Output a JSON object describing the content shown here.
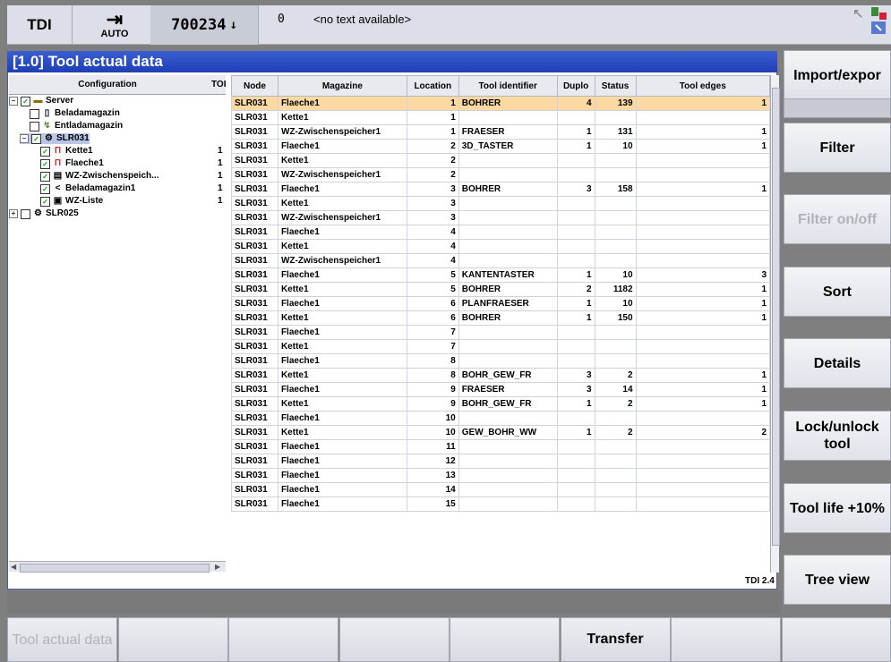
{
  "topbar": {
    "channel": "TDI",
    "mode_label": "AUTO",
    "mode_icon": "mode-arrow-icon",
    "program": "700234",
    "program_icon": "down-arrow-icon",
    "alarm_number": "0",
    "alarm_text": "<no text available>"
  },
  "panel": {
    "title": "[1.0] Tool actual data",
    "version": "TDI 2.4"
  },
  "tree": {
    "col_config": "Configuration",
    "col_to": "TOI",
    "nodes": [
      {
        "label": "Server",
        "level": 0,
        "exp": "−",
        "checked": true,
        "icon": "folder-icon",
        "count": ""
      },
      {
        "label": "Beladamagazin",
        "level": 1,
        "exp": "",
        "checked": false,
        "icon": "magazine-icon",
        "count": ""
      },
      {
        "label": "Entladamagazin",
        "level": 1,
        "exp": "",
        "checked": false,
        "icon": "unload-icon",
        "count": ""
      },
      {
        "label": "SLR031",
        "level": 1,
        "exp": "−",
        "checked": true,
        "icon": "machine-icon",
        "count": "",
        "selected": true
      },
      {
        "label": "Kette1",
        "level": 2,
        "exp": "",
        "checked": true,
        "icon": "chain-magazine-icon",
        "count": "1"
      },
      {
        "label": "Flaeche1",
        "level": 2,
        "exp": "",
        "checked": true,
        "icon": "flat-magazine-icon",
        "count": "1"
      },
      {
        "label": "WZ-Zwischenspeich...",
        "level": 2,
        "exp": "",
        "checked": true,
        "icon": "buffer-icon",
        "count": "1"
      },
      {
        "label": "Beladamagazin1",
        "level": 2,
        "exp": "",
        "checked": true,
        "icon": "load-icon",
        "count": "1"
      },
      {
        "label": "WZ-Liste",
        "level": 2,
        "exp": "",
        "checked": true,
        "icon": "list-icon",
        "count": "1"
      },
      {
        "label": "SLR025",
        "level": 0,
        "exp": "+",
        "checked": false,
        "icon": "machine-icon",
        "count": ""
      }
    ]
  },
  "table": {
    "columns": [
      "Node",
      "Magazine",
      "Location",
      "Tool identifier",
      "Duplo",
      "Status",
      "Tool edges"
    ],
    "rows": [
      [
        "SLR031",
        "Flaeche1",
        "1",
        "BOHRER",
        "4",
        "139",
        "1"
      ],
      [
        "SLR031",
        "Kette1",
        "1",
        "",
        "",
        "",
        ""
      ],
      [
        "SLR031",
        "WZ-Zwischenspeicher1",
        "1",
        "FRAESER",
        "1",
        "131",
        "1"
      ],
      [
        "SLR031",
        "Flaeche1",
        "2",
        "3D_TASTER",
        "1",
        "10",
        "1"
      ],
      [
        "SLR031",
        "Kette1",
        "2",
        "",
        "",
        "",
        ""
      ],
      [
        "SLR031",
        "WZ-Zwischenspeicher1",
        "2",
        "",
        "",
        "",
        ""
      ],
      [
        "SLR031",
        "Flaeche1",
        "3",
        "BOHRER",
        "3",
        "158",
        "1"
      ],
      [
        "SLR031",
        "Kette1",
        "3",
        "",
        "",
        "",
        ""
      ],
      [
        "SLR031",
        "WZ-Zwischenspeicher1",
        "3",
        "",
        "",
        "",
        ""
      ],
      [
        "SLR031",
        "Flaeche1",
        "4",
        "",
        "",
        "",
        ""
      ],
      [
        "SLR031",
        "Kette1",
        "4",
        "",
        "",
        "",
        ""
      ],
      [
        "SLR031",
        "WZ-Zwischenspeicher1",
        "4",
        "",
        "",
        "",
        ""
      ],
      [
        "SLR031",
        "Flaeche1",
        "5",
        "KANTENTASTER",
        "1",
        "10",
        "3"
      ],
      [
        "SLR031",
        "Kette1",
        "5",
        "BOHRER",
        "2",
        "1182",
        "1"
      ],
      [
        "SLR031",
        "Flaeche1",
        "6",
        "PLANFRAESER",
        "1",
        "10",
        "1"
      ],
      [
        "SLR031",
        "Kette1",
        "6",
        "BOHRER",
        "1",
        "150",
        "1"
      ],
      [
        "SLR031",
        "Flaeche1",
        "7",
        "",
        "",
        "",
        ""
      ],
      [
        "SLR031",
        "Kette1",
        "7",
        "",
        "",
        "",
        ""
      ],
      [
        "SLR031",
        "Flaeche1",
        "8",
        "",
        "",
        "",
        ""
      ],
      [
        "SLR031",
        "Kette1",
        "8",
        "BOHR_GEW_FR",
        "3",
        "2",
        "1"
      ],
      [
        "SLR031",
        "Flaeche1",
        "9",
        "FRAESER",
        "3",
        "14",
        "1"
      ],
      [
        "SLR031",
        "Kette1",
        "9",
        "BOHR_GEW_FR",
        "1",
        "2",
        "1"
      ],
      [
        "SLR031",
        "Flaeche1",
        "10",
        "",
        "",
        "",
        ""
      ],
      [
        "SLR031",
        "Kette1",
        "10",
        "GEW_BOHR_WW",
        "1",
        "2",
        "2"
      ],
      [
        "SLR031",
        "Flaeche1",
        "11",
        "",
        "",
        "",
        ""
      ],
      [
        "SLR031",
        "Flaeche1",
        "12",
        "",
        "",
        "",
        ""
      ],
      [
        "SLR031",
        "Flaeche1",
        "13",
        "",
        "",
        "",
        ""
      ],
      [
        "SLR031",
        "Flaeche1",
        "14",
        "",
        "",
        "",
        ""
      ],
      [
        "SLR031",
        "Flaeche1",
        "15",
        "",
        "",
        "",
        ""
      ]
    ]
  },
  "softkeys_right": [
    {
      "label": "Import/expor",
      "state": "normal"
    },
    {
      "label": "",
      "state": "empty"
    },
    {
      "label": "Filter",
      "state": "normal"
    },
    {
      "label": "Filter on/off",
      "state": "disabled"
    },
    {
      "label": "Sort",
      "state": "normal"
    },
    {
      "label": "Details",
      "state": "normal"
    },
    {
      "label": "Lock/unlock tool",
      "state": "normal"
    },
    {
      "label": "Tool life +10%",
      "state": "normal"
    },
    {
      "label": "Tree view",
      "state": "normal"
    }
  ],
  "softkeys_bottom": [
    {
      "label": "Tool actual data",
      "state": "disabled"
    },
    {
      "label": "",
      "state": "normal"
    },
    {
      "label": "",
      "state": "normal"
    },
    {
      "label": "",
      "state": "normal"
    },
    {
      "label": "",
      "state": "normal"
    },
    {
      "label": "Transfer",
      "state": "normal"
    },
    {
      "label": "",
      "state": "normal"
    },
    {
      "label": "",
      "state": "normal"
    }
  ]
}
